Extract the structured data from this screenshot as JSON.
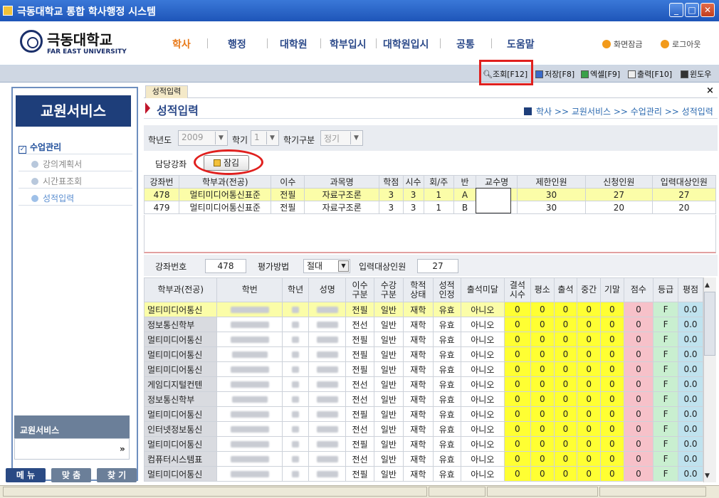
{
  "window": {
    "title": "극동대학교 통합 학사행정 시스템"
  },
  "header": {
    "logo_name": "극동대학교",
    "logo_sub": "FAR EAST UNIVERSITY",
    "menus": [
      "학사",
      "행정",
      "대학원",
      "학부입시",
      "대학원입시",
      "공통",
      "도움말"
    ],
    "lock_screen": "화면잠금",
    "logout": "로그아웃"
  },
  "toolbar": {
    "search": "조회[F12]",
    "save": "저장[F8]",
    "excel": "엑셀[F9]",
    "print": "출력[F10]",
    "window": "윈도우"
  },
  "sidebar": {
    "title": "교원서비스",
    "category": "수업관리",
    "items": [
      "강의계획서",
      "시간표조회",
      "성적입력"
    ],
    "bottom_label": "교원서비스",
    "bottom_arrow": "»",
    "buttons": [
      "메 뉴",
      "맞 춤",
      "찾 기"
    ]
  },
  "main": {
    "tab": "성적입력",
    "tab_close": "×",
    "page_title": "성적입력",
    "breadcrumb": "학사 >> 교원서비스 >> 수업관리 >> 성적입력",
    "filter": {
      "year_label": "학년도",
      "year_value": "2009",
      "grade_label": "학기",
      "grade_value": "1",
      "term_type_label": "학기구분",
      "term_type_value": "정기"
    },
    "course_label": "담당강좌",
    "lock_button": "잠김"
  },
  "course_table": {
    "headers": [
      "강좌번",
      "학부과(전공)",
      "이수",
      "과목명",
      "학점",
      "시수",
      "회/주",
      "반",
      "교수명",
      "제한인원",
      "신청인원",
      "입력대상인원"
    ],
    "rows": [
      [
        "478",
        "멀티미디어통신표준",
        "전필",
        "자료구조론",
        "3",
        "3",
        "1",
        "A",
        "",
        "30",
        "27",
        "27"
      ],
      [
        "479",
        "멀티미디어통신표준",
        "전필",
        "자료구조론",
        "3",
        "3",
        "1",
        "B",
        "",
        "30",
        "20",
        "20"
      ]
    ]
  },
  "grade_panel": {
    "course_no_label": "강좌번호",
    "course_no": "478",
    "eval_label": "평가방법",
    "eval_value": "절대",
    "target_label": "입력대상인원",
    "target_value": "27"
  },
  "student_table": {
    "headers": [
      "학부과(전공)",
      "학번",
      "학년",
      "성명",
      "이수\n구분",
      "수강\n구분",
      "학적\n상태",
      "성적\n인정",
      "출석미달",
      "결석\n시수",
      "평소",
      "출석",
      "중간",
      "기말",
      "점수",
      "등급",
      "평점"
    ],
    "rows": [
      [
        "멀티미디어통신",
        "전필",
        "일반",
        "재학",
        "유효",
        "아니오",
        "0",
        "0",
        "0",
        "0",
        "0",
        "0",
        "F",
        "0.0"
      ],
      [
        "정보통신학부",
        "전선",
        "일반",
        "재학",
        "유효",
        "아니오",
        "0",
        "0",
        "0",
        "0",
        "0",
        "0",
        "F",
        "0.0"
      ],
      [
        "멀티미디어통신",
        "전필",
        "일반",
        "재학",
        "유효",
        "아니오",
        "0",
        "0",
        "0",
        "0",
        "0",
        "0",
        "F",
        "0.0"
      ],
      [
        "멀티미디어통신",
        "전필",
        "일반",
        "재학",
        "유효",
        "아니오",
        "0",
        "0",
        "0",
        "0",
        "0",
        "0",
        "F",
        "0.0"
      ],
      [
        "멀티미디어통신",
        "전필",
        "일반",
        "재학",
        "유효",
        "아니오",
        "0",
        "0",
        "0",
        "0",
        "0",
        "0",
        "F",
        "0.0"
      ],
      [
        "게임디지털컨텐",
        "전선",
        "일반",
        "재학",
        "유효",
        "아니오",
        "0",
        "0",
        "0",
        "0",
        "0",
        "0",
        "F",
        "0.0"
      ],
      [
        "정보통신학부",
        "전선",
        "일반",
        "재학",
        "유효",
        "아니오",
        "0",
        "0",
        "0",
        "0",
        "0",
        "0",
        "F",
        "0.0"
      ],
      [
        "멀티미디어통신",
        "전필",
        "일반",
        "재학",
        "유효",
        "아니오",
        "0",
        "0",
        "0",
        "0",
        "0",
        "0",
        "F",
        "0.0"
      ],
      [
        "인터넷정보통신",
        "전선",
        "일반",
        "재학",
        "유효",
        "아니오",
        "0",
        "0",
        "0",
        "0",
        "0",
        "0",
        "F",
        "0.0"
      ],
      [
        "멀티미디어통신",
        "전필",
        "일반",
        "재학",
        "유효",
        "아니오",
        "0",
        "0",
        "0",
        "0",
        "0",
        "0",
        "F",
        "0.0"
      ],
      [
        "컴퓨터시스템표",
        "전선",
        "일반",
        "재학",
        "유효",
        "아니오",
        "0",
        "0",
        "0",
        "0",
        "0",
        "0",
        "F",
        "0.0"
      ],
      [
        "멀티미디어통신",
        "전필",
        "일반",
        "재학",
        "유효",
        "아니오",
        "0",
        "0",
        "0",
        "0",
        "0",
        "0",
        "F",
        "0.0"
      ]
    ]
  },
  "colors": {
    "brand_navy": "#1e3e7a",
    "menu_active": "#e87a1a",
    "highlight": "#fbfda8",
    "score_yellow": "#ffff33"
  }
}
